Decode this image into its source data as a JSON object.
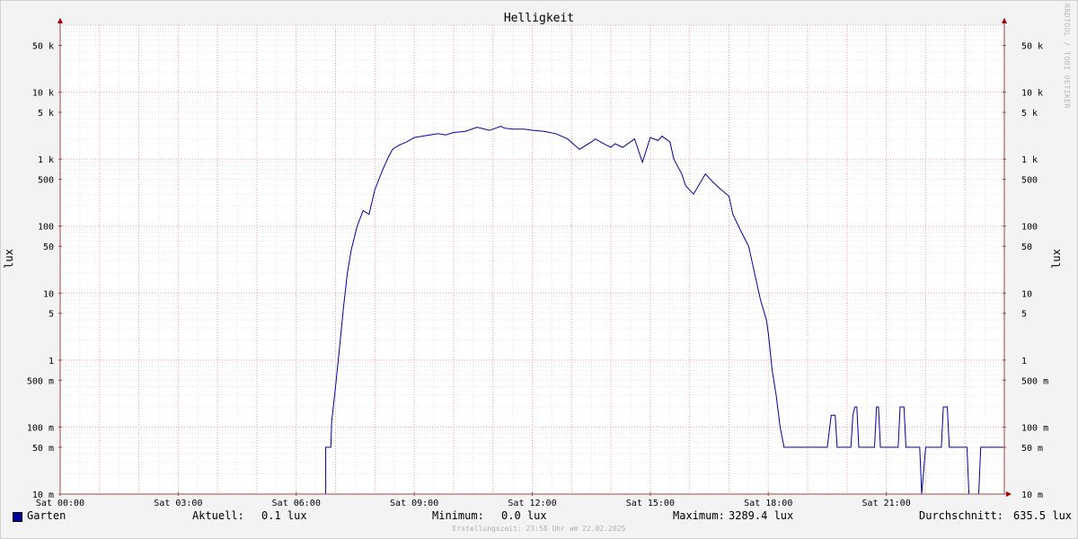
{
  "chart_data": {
    "type": "line",
    "title": "Helligkeit",
    "ylabel": "lux",
    "yscale": "log",
    "ylim": [
      0.01,
      100000
    ],
    "xlim_hours": [
      0,
      24
    ],
    "y_ticks": [
      {
        "v": 0.01,
        "label": "10 m"
      },
      {
        "v": 0.05,
        "label": "50 m"
      },
      {
        "v": 0.1,
        "label": "100 m"
      },
      {
        "v": 0.5,
        "label": "500 m"
      },
      {
        "v": 1,
        "label": "1"
      },
      {
        "v": 5,
        "label": "5"
      },
      {
        "v": 10,
        "label": "10"
      },
      {
        "v": 50,
        "label": "50"
      },
      {
        "v": 100,
        "label": "100"
      },
      {
        "v": 500,
        "label": "500"
      },
      {
        "v": 1000,
        "label": "1 k"
      },
      {
        "v": 5000,
        "label": "5 k"
      },
      {
        "v": 10000,
        "label": "10 k"
      },
      {
        "v": 50000,
        "label": "50 k"
      }
    ],
    "x_ticks": [
      {
        "h": 0,
        "label": "Sat 00:00"
      },
      {
        "h": 3,
        "label": "Sat 03:00"
      },
      {
        "h": 6,
        "label": "Sat 06:00"
      },
      {
        "h": 9,
        "label": "Sat 09:00"
      },
      {
        "h": 12,
        "label": "Sat 12:00"
      },
      {
        "h": 15,
        "label": "Sat 15:00"
      },
      {
        "h": 18,
        "label": "Sat 18:00"
      },
      {
        "h": 21,
        "label": "Sat 21:00"
      }
    ],
    "grid": true,
    "series": [
      {
        "name": "Garten",
        "color": "#0000a0",
        "x": [
          0,
          6.75,
          6.75,
          6.88,
          6.9,
          7.0,
          7.1,
          7.2,
          7.3,
          7.4,
          7.55,
          7.7,
          7.85,
          8.0,
          8.2,
          8.35,
          8.45,
          8.6,
          8.8,
          9.0,
          9.2,
          9.4,
          9.6,
          9.8,
          10.0,
          10.3,
          10.6,
          10.9,
          11.0,
          11.2,
          11.3,
          11.5,
          11.8,
          12.0,
          12.3,
          12.6,
          12.9,
          13.2,
          13.5,
          13.6,
          13.9,
          14.0,
          14.1,
          14.3,
          14.6,
          14.8,
          15.0,
          15.2,
          15.3,
          15.5,
          15.6,
          15.8,
          15.9,
          16.1,
          16.4,
          16.6,
          16.8,
          17.0,
          17.1,
          17.3,
          17.5,
          17.65,
          17.8,
          17.95,
          18.0,
          18.1,
          18.2,
          18.3,
          18.4,
          18.6,
          18.9,
          19.2,
          19.5,
          19.6,
          19.7,
          19.75,
          19.8,
          20.1,
          20.15,
          20.2,
          20.25,
          20.3,
          20.7,
          20.75,
          20.8,
          20.85,
          21.3,
          21.35,
          21.45,
          21.5,
          21.85,
          21.9,
          22.0,
          22.05,
          22.4,
          22.45,
          22.55,
          22.6,
          23.05,
          23.1,
          23.35,
          23.4,
          24.0
        ],
        "y": [
          0.01,
          0.01,
          0.05,
          0.05,
          0.12,
          0.4,
          1.5,
          6,
          20,
          45,
          100,
          170,
          150,
          350,
          700,
          1100,
          1400,
          1600,
          1800,
          2100,
          2200,
          2300,
          2400,
          2300,
          2500,
          2600,
          3000,
          2700,
          2800,
          3100,
          2900,
          2800,
          2800,
          2700,
          2600,
          2400,
          2000,
          1400,
          1800,
          2000,
          1600,
          1500,
          1700,
          1500,
          2000,
          900,
          2100,
          1900,
          2200,
          1800,
          1000,
          600,
          400,
          300,
          600,
          450,
          350,
          280,
          150,
          85,
          50,
          20,
          8,
          4,
          2.5,
          0.7,
          0.3,
          0.1,
          0.05,
          0.05,
          0.05,
          0.05,
          0.05,
          0.15,
          0.15,
          0.05,
          0.05,
          0.05,
          0.15,
          0.2,
          0.2,
          0.05,
          0.05,
          0.2,
          0.2,
          0.05,
          0.05,
          0.2,
          0.2,
          0.05,
          0.05,
          0.01,
          0.05,
          0.05,
          0.05,
          0.2,
          0.2,
          0.05,
          0.05,
          0.01,
          0.01,
          0.05,
          0.05
        ]
      }
    ]
  },
  "legend": {
    "series_name": "Garten",
    "current_label": "Aktuell:",
    "current_value": "0.1 lux",
    "min_label": "Minimum:",
    "min_value": "0.0 lux",
    "max_label": "Maximum:",
    "max_value": "3289.4 lux",
    "avg_label": "Durchschnitt:",
    "avg_value": "635.5 lux"
  },
  "footer": "Erstellungszeit: 23:58 Uhr am 22.02.2025",
  "watermark": "RRDTOOL / TOBI OETIKER"
}
